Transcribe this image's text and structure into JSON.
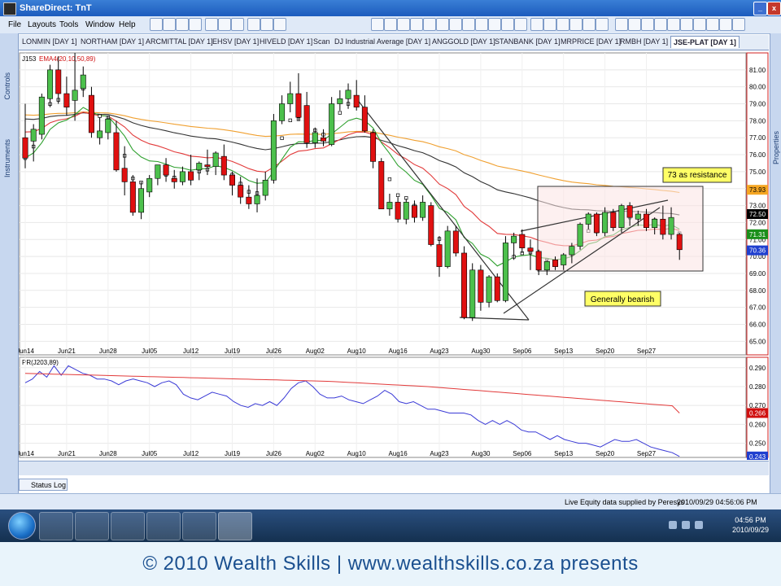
{
  "window": {
    "title": "ShareDirect: TnT"
  },
  "menu": [
    "File",
    "Layouts",
    "Tools",
    "Window",
    "Help"
  ],
  "side_panels": {
    "left": [
      "Controls",
      "Instruments"
    ],
    "right": [
      "Properties"
    ]
  },
  "tabs": [
    "LONMIN [DAY 1]",
    "NORTHAM [DAY 1]",
    "ARCMITTAL [DAY 1]",
    "EHSV [DAY 1]",
    "HIVELD [DAY 1]",
    "Scan",
    "DJ Industrial Average [DAY 1]",
    "ANGGOLD [DAY 1]",
    "STANBANK [DAY 1]",
    "MRPRICE [DAY 1]",
    "RMBH [DAY 1]",
    "JSE-PLAT [DAY 1]"
  ],
  "active_tab": "JSE-PLAT [DAY 1]",
  "chart_data": [
    {
      "type": "candlestick",
      "label": "J153",
      "indicator_label": "EMA4(20,10,50,89)",
      "ylim": [
        64.2,
        82.0
      ],
      "yticks": [
        65.0,
        66.0,
        67.0,
        68.0,
        69.0,
        70.0,
        71.0,
        72.0,
        73.0,
        74.0,
        75.0,
        76.0,
        77.0,
        78.0,
        79.0,
        80.0,
        81.0
      ],
      "xtick_labels": [
        "Jun14",
        "Jun21",
        "Jun28",
        "Jul05",
        "Jul12",
        "Jul19",
        "Jul26",
        "Aug02",
        "Aug10",
        "Aug16",
        "Aug23",
        "Aug30",
        "Sep06",
        "Sep13",
        "Sep20",
        "Sep27"
      ],
      "price_tags": [
        {
          "value": 73.93,
          "color": "#f5a623"
        },
        {
          "value": 72.5,
          "color": "#000000"
        },
        {
          "value": 71.31,
          "color": "#1a8f1a"
        },
        {
          "value": 70.36,
          "color": "#1f3fcf"
        }
      ],
      "candles": [
        [
          77.0,
          79.0,
          75.2,
          75.8
        ],
        [
          76.8,
          77.8,
          75.6,
          77.5
        ],
        [
          77.2,
          79.6,
          76.9,
          79.4
        ],
        [
          79.3,
          81.3,
          78.8,
          81.0
        ],
        [
          81.0,
          81.8,
          79.0,
          79.6
        ],
        [
          79.6,
          80.6,
          78.3,
          78.8
        ],
        [
          79.2,
          82.0,
          78.0,
          79.8
        ],
        [
          79.9,
          81.2,
          79.4,
          80.7
        ],
        [
          79.5,
          80.0,
          77.0,
          77.3
        ],
        [
          77.0,
          78.2,
          76.6,
          77.4
        ],
        [
          77.3,
          78.3,
          76.9,
          78.1
        ],
        [
          77.3,
          78.0,
          75.0,
          75.1
        ],
        [
          75.2,
          76.5,
          73.6,
          74.4
        ],
        [
          74.4,
          74.8,
          72.4,
          72.6
        ],
        [
          72.6,
          74.4,
          72.2,
          74.0
        ],
        [
          73.8,
          74.8,
          73.5,
          74.6
        ],
        [
          74.6,
          75.4,
          74.2,
          75.4
        ],
        [
          75.4,
          75.8,
          74.4,
          74.8
        ],
        [
          74.6,
          75.1,
          74.0,
          74.4
        ],
        [
          74.4,
          75.3,
          74.2,
          75.0
        ],
        [
          75.0,
          76.0,
          74.2,
          74.5
        ],
        [
          75.1,
          75.6,
          74.5,
          75.5
        ],
        [
          75.4,
          76.3,
          74.8,
          75.3
        ],
        [
          75.3,
          76.2,
          74.8,
          76.1
        ],
        [
          75.9,
          76.6,
          74.5,
          74.8
        ],
        [
          74.8,
          75.0,
          73.6,
          74.2
        ],
        [
          74.2,
          74.7,
          73.1,
          73.5
        ],
        [
          73.5,
          74.2,
          72.8,
          73.1
        ],
        [
          73.1,
          74.6,
          72.6,
          73.6
        ],
        [
          73.6,
          75.0,
          73.3,
          74.5
        ],
        [
          74.5,
          78.4,
          74.3,
          78.0
        ],
        [
          78.0,
          79.5,
          77.8,
          79.0
        ],
        [
          79.0,
          80.3,
          78.5,
          79.6
        ],
        [
          79.6,
          80.8,
          78.0,
          78.2
        ],
        [
          78.9,
          79.7,
          76.4,
          76.7
        ],
        [
          76.7,
          77.6,
          76.4,
          77.3
        ],
        [
          77.0,
          77.5,
          76.5,
          76.8
        ],
        [
          76.6,
          79.4,
          76.5,
          79.0
        ],
        [
          79.0,
          79.8,
          78.6,
          79.3
        ],
        [
          79.3,
          80.2,
          78.7,
          79.8
        ],
        [
          79.5,
          80.4,
          78.6,
          78.8
        ],
        [
          78.8,
          79.5,
          77.3,
          77.4
        ],
        [
          77.3,
          77.5,
          75.2,
          75.6
        ],
        [
          75.6,
          75.8,
          72.8,
          72.8
        ],
        [
          72.8,
          73.7,
          72.4,
          73.2
        ],
        [
          73.2,
          73.5,
          72.0,
          72.2
        ],
        [
          72.2,
          73.4,
          71.9,
          73.2
        ],
        [
          73.0,
          73.3,
          72.0,
          72.3
        ],
        [
          72.3,
          73.6,
          72.1,
          73.2
        ],
        [
          73.0,
          73.2,
          70.6,
          70.7
        ],
        [
          70.7,
          71.2,
          68.8,
          69.4
        ],
        [
          69.4,
          71.8,
          69.3,
          71.5
        ],
        [
          71.5,
          71.8,
          70.0,
          70.2
        ],
        [
          70.2,
          70.6,
          66.3,
          66.4
        ],
        [
          66.4,
          69.6,
          66.2,
          69.2
        ],
        [
          69.2,
          69.5,
          66.8,
          67.3
        ],
        [
          67.3,
          68.9,
          67.0,
          68.8
        ],
        [
          68.8,
          69.0,
          67.3,
          67.4
        ],
        [
          67.4,
          71.2,
          67.3,
          70.8
        ],
        [
          70.8,
          71.4,
          69.8,
          71.2
        ],
        [
          71.3,
          71.6,
          70.2,
          70.5
        ],
        [
          70.5,
          71.0,
          69.2,
          70.3
        ],
        [
          70.3,
          70.4,
          68.9,
          69.2
        ],
        [
          69.2,
          69.8,
          68.9,
          69.7
        ],
        [
          69.8,
          70.0,
          69.2,
          69.4
        ],
        [
          69.5,
          70.2,
          69.2,
          70.1
        ],
        [
          70.1,
          70.8,
          69.6,
          70.6
        ],
        [
          70.6,
          72.0,
          70.4,
          71.9
        ],
        [
          71.9,
          72.6,
          71.6,
          72.5
        ],
        [
          72.5,
          72.6,
          71.2,
          71.4
        ],
        [
          71.4,
          72.9,
          71.2,
          72.6
        ],
        [
          72.6,
          72.8,
          71.5,
          71.7
        ],
        [
          71.7,
          73.1,
          71.4,
          73.0
        ],
        [
          73.0,
          73.2,
          71.8,
          72.3
        ],
        [
          72.2,
          72.7,
          71.8,
          72.5
        ],
        [
          72.5,
          72.8,
          71.5,
          71.7
        ],
        [
          71.7,
          72.3,
          71.3,
          72.2
        ],
        [
          72.2,
          73.0,
          71.0,
          71.3
        ],
        [
          71.3,
          72.9,
          71.0,
          72.3
        ],
        [
          71.3,
          71.4,
          69.8,
          70.4
        ]
      ],
      "annotations": [
        "73 as resistance",
        "Generally bearish"
      ]
    },
    {
      "type": "line",
      "label": "PR(J203,89)",
      "ylim": [
        0.2425,
        0.2955
      ],
      "yticks": [
        0.25,
        0.26,
        0.27,
        0.28,
        0.29
      ],
      "xtick_labels": [
        "Jun14",
        "Jun21",
        "Jun28",
        "Jul05",
        "Jul12",
        "Jul19",
        "Jul26",
        "Aug02",
        "Aug10",
        "Aug16",
        "Aug23",
        "Aug30",
        "Sep06",
        "Sep13",
        "Sep20",
        "Sep27"
      ],
      "value_tags": [
        {
          "value": 0.266,
          "color": "#d01010"
        },
        {
          "value": 0.243,
          "color": "#1f3fcf"
        }
      ],
      "series": [
        {
          "color": "#3a3ad6",
          "values": [
            0.282,
            0.284,
            0.288,
            0.285,
            0.291,
            0.286,
            0.291,
            0.289,
            0.287,
            0.286,
            0.284,
            0.284,
            0.283,
            0.281,
            0.283,
            0.284,
            0.283,
            0.282,
            0.28,
            0.282,
            0.283,
            0.281,
            0.276,
            0.274,
            0.273,
            0.275,
            0.277,
            0.276,
            0.275,
            0.272,
            0.27,
            0.269,
            0.271,
            0.27,
            0.272,
            0.27,
            0.274,
            0.279,
            0.282,
            0.283,
            0.28,
            0.276,
            0.274,
            0.274,
            0.275,
            0.273,
            0.272,
            0.271,
            0.273,
            0.275,
            0.278,
            0.276,
            0.272,
            0.271,
            0.272,
            0.27,
            0.268,
            0.268,
            0.267,
            0.266,
            0.266,
            0.266,
            0.265,
            0.262,
            0.26,
            0.262,
            0.26,
            0.262,
            0.26,
            0.257,
            0.256,
            0.256,
            0.254,
            0.252,
            0.254,
            0.252,
            0.251,
            0.25,
            0.25,
            0.249,
            0.248,
            0.25,
            0.252,
            0.251,
            0.251,
            0.252,
            0.25,
            0.248,
            0.247,
            0.246,
            0.245,
            0.243
          ]
        },
        {
          "color": "#e23a3a",
          "values": [
            0.287,
            0.2869,
            0.2868,
            0.2867,
            0.2866,
            0.2865,
            0.2864,
            0.2863,
            0.2862,
            0.2861,
            0.286,
            0.2859,
            0.2858,
            0.2857,
            0.2856,
            0.2855,
            0.2854,
            0.2853,
            0.2852,
            0.2851,
            0.285,
            0.2849,
            0.2848,
            0.2847,
            0.2846,
            0.2845,
            0.2844,
            0.2843,
            0.2842,
            0.2841,
            0.284,
            0.2839,
            0.2838,
            0.2837,
            0.2836,
            0.2835,
            0.2834,
            0.2833,
            0.2832,
            0.2831,
            0.283,
            0.2829,
            0.2828,
            0.2826,
            0.2824,
            0.2822,
            0.282,
            0.2818,
            0.2816,
            0.2814,
            0.2812,
            0.281,
            0.2808,
            0.2806,
            0.2804,
            0.2802,
            0.28,
            0.2797,
            0.2794,
            0.2791,
            0.2788,
            0.2785,
            0.2782,
            0.2779,
            0.2776,
            0.2773,
            0.277,
            0.2767,
            0.2764,
            0.2761,
            0.2758,
            0.2755,
            0.2752,
            0.2749,
            0.2746,
            0.2743,
            0.274,
            0.2737,
            0.2734,
            0.2731,
            0.2728,
            0.2725,
            0.2722,
            0.2719,
            0.2716,
            0.2713,
            0.271,
            0.2707,
            0.2704,
            0.2701,
            0.2698,
            0.266
          ]
        }
      ]
    }
  ],
  "status": {
    "supplier": "Live Equity data supplied by Peresys",
    "timestamp": "2010/09/29 04:56:06 PM",
    "log": "Status Log"
  },
  "taskbar": {
    "time": "04:56 PM",
    "date": "2010/09/29"
  },
  "footer": "© 2010 Wealth Skills | www.wealthskills.co.za presents"
}
